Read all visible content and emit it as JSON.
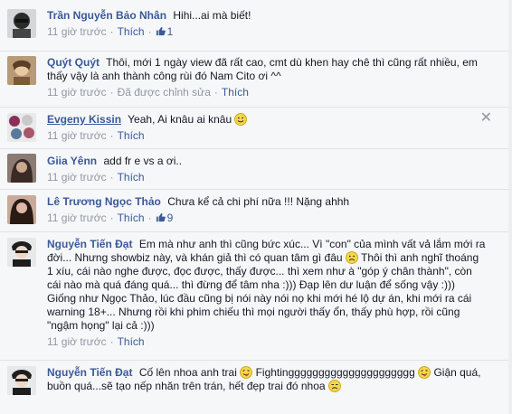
{
  "comments": [
    {
      "author": "Trần Nguyễn Bảo Nhân",
      "text": "Hihi...ai mà biết!",
      "time": "11 giờ trước",
      "like_label": "Thích",
      "like_count": "1",
      "avatar_colors": [
        "#2b2b2b",
        "#dedede"
      ]
    },
    {
      "author": "Quýt Quýt",
      "text": "Thôi, mới 1 ngày view đã rất cao, cmt dù khen hay chê thì cũng rất nhiều, em thấy vậy là anh thành công rùi đó Nam Cito ơi ^^",
      "time": "11 giờ trước",
      "edited": "Đã được chỉnh sửa",
      "like_label": "Thích",
      "avatar_colors": [
        "#7a5a3a",
        "#e8c9a0"
      ]
    },
    {
      "author": "Evgeny Kissin",
      "text": "Yeah, Ai knâu ai knâu",
      "emoji": "smile",
      "time": "11 giờ trước",
      "like_label": "Thích",
      "close_glyph": "✕",
      "avatar_colors": [
        "#d9d9d9",
        "#8b2f5a"
      ]
    },
    {
      "author": "Giia Yênn",
      "text": "add fr e vs a ơi..",
      "time": "11 giờ trước",
      "like_label": "Thích",
      "avatar_colors": [
        "#3a2a25",
        "#caa890"
      ]
    },
    {
      "author": "Lê Trương Ngọc Thảo",
      "text": "Chưa kể cả chi phí nữa !!! Nặng ahhh",
      "time": "11 giờ trước",
      "like_label": "Thích",
      "like_count": "9",
      "avatar_colors": [
        "#2a1a14",
        "#e0b8a8"
      ]
    },
    {
      "author": "Nguyễn Tiến Đạt",
      "text_parts": [
        "Em mà như anh thì cũng bức xúc... Vì \"con\" của mình vất vả lắm mới ra đời... Nhưng showbiz này, và khán giả thì có quan tâm gì đâu",
        "Thôi thì anh nghĩ thoáng 1 xíu, cái nào nghe được, đọc được, thấy được... thì xem như à \"góp ý chân thành\", còn cái nào mà quá đáng quá... thì đừng để tâm nha :))) Đạp lên dư luận để sống vậy :))) Giống như Ngọc Thảo, lúc đầu cũng bị nói này nói nọ khi mới hé lộ dự án, khi mới ra cái warning 18+... Nhưng rồi khi phim chiếu thì mọi người thấy ổn, thấy phù hợp, rồi cũng \"ngậm họng\" lại cả :)))"
      ],
      "emoji": "sad",
      "time": "11 giờ trước",
      "like_label": "Thích",
      "avatar_colors": [
        "#1e1e1e",
        "#e8e8e8"
      ]
    },
    {
      "author": "Nguyễn Tiến Đạt",
      "text_parts": [
        "Cố lên nhoa anh trai",
        "Fightinggggggggggggggggggggg",
        "Giận quá, buồn quá...sẽ tạo nếp nhăn trên trán, hết đẹp trai đó nhoa"
      ],
      "time": "11 giờ trước",
      "like_label": "Thích",
      "avatar_colors": [
        "#1e1e1e",
        "#e8e8e8"
      ]
    }
  ],
  "colors": {
    "link": "#3b5998",
    "meta": "#9197a3",
    "background": "#f6f7f9",
    "divider": "#e1e2e3"
  }
}
